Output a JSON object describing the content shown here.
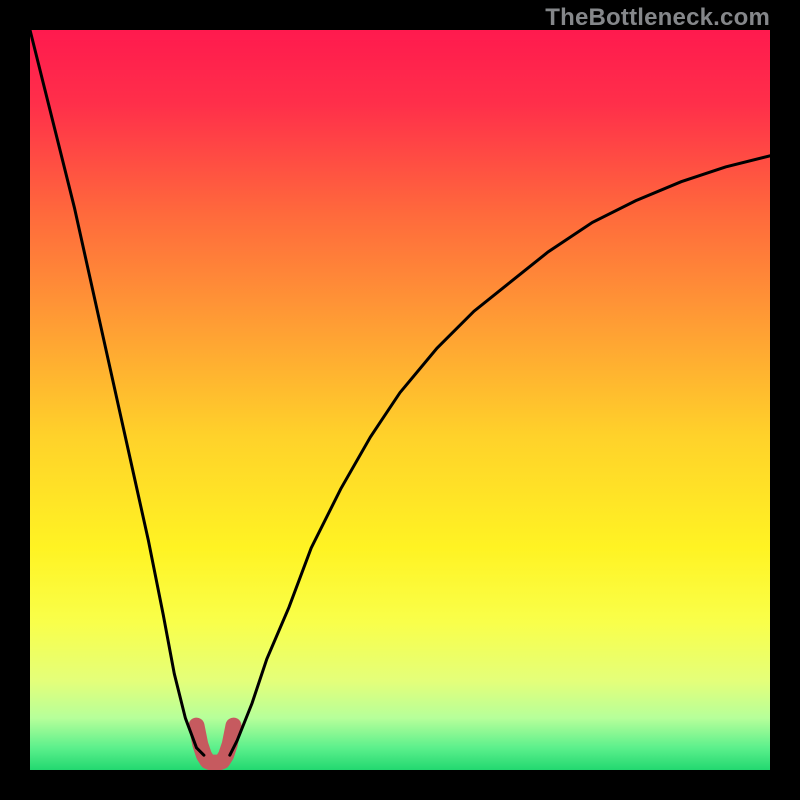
{
  "watermark": "TheBottleneck.com",
  "chart_data": {
    "type": "line",
    "title": "",
    "xlabel": "",
    "ylabel": "",
    "xlim": [
      0,
      100
    ],
    "ylim": [
      0,
      100
    ],
    "grid": false,
    "legend": false,
    "series": [
      {
        "name": "left-descending-curve",
        "x": [
          0,
          2,
          4,
          6,
          8,
          10,
          12,
          14,
          16,
          18,
          19.5,
          21,
          22.5,
          23.5
        ],
        "y": [
          100,
          92,
          84,
          76,
          67,
          58,
          49,
          40,
          31,
          21,
          13,
          7,
          3,
          2
        ]
      },
      {
        "name": "right-ascending-curve",
        "x": [
          27,
          28,
          30,
          32,
          35,
          38,
          42,
          46,
          50,
          55,
          60,
          65,
          70,
          76,
          82,
          88,
          94,
          100
        ],
        "y": [
          2,
          4,
          9,
          15,
          22,
          30,
          38,
          45,
          51,
          57,
          62,
          66,
          70,
          74,
          77,
          79.5,
          81.5,
          83
        ]
      },
      {
        "name": "red-valley-marker",
        "x": [
          22.5,
          23,
          23.5,
          24,
          24.5,
          25,
          25.5,
          26,
          26.5,
          27,
          27.5
        ],
        "y": [
          6,
          3.5,
          2,
          1.2,
          1,
          1,
          1,
          1.2,
          2,
          3.5,
          6
        ]
      }
    ],
    "background_gradient": {
      "stops": [
        {
          "offset": 0.0,
          "color": "#ff1a4e"
        },
        {
          "offset": 0.1,
          "color": "#ff2f4a"
        },
        {
          "offset": 0.25,
          "color": "#ff6a3c"
        },
        {
          "offset": 0.4,
          "color": "#ff9e34"
        },
        {
          "offset": 0.55,
          "color": "#ffd22a"
        },
        {
          "offset": 0.7,
          "color": "#fff323"
        },
        {
          "offset": 0.8,
          "color": "#f9ff4a"
        },
        {
          "offset": 0.88,
          "color": "#e4ff7a"
        },
        {
          "offset": 0.93,
          "color": "#b6ff9a"
        },
        {
          "offset": 0.97,
          "color": "#5cf08c"
        },
        {
          "offset": 1.0,
          "color": "#22d870"
        }
      ]
    },
    "styles": {
      "curve_color": "#000000",
      "curve_width": 3,
      "marker_color": "#c65a5f",
      "marker_width": 16
    }
  }
}
